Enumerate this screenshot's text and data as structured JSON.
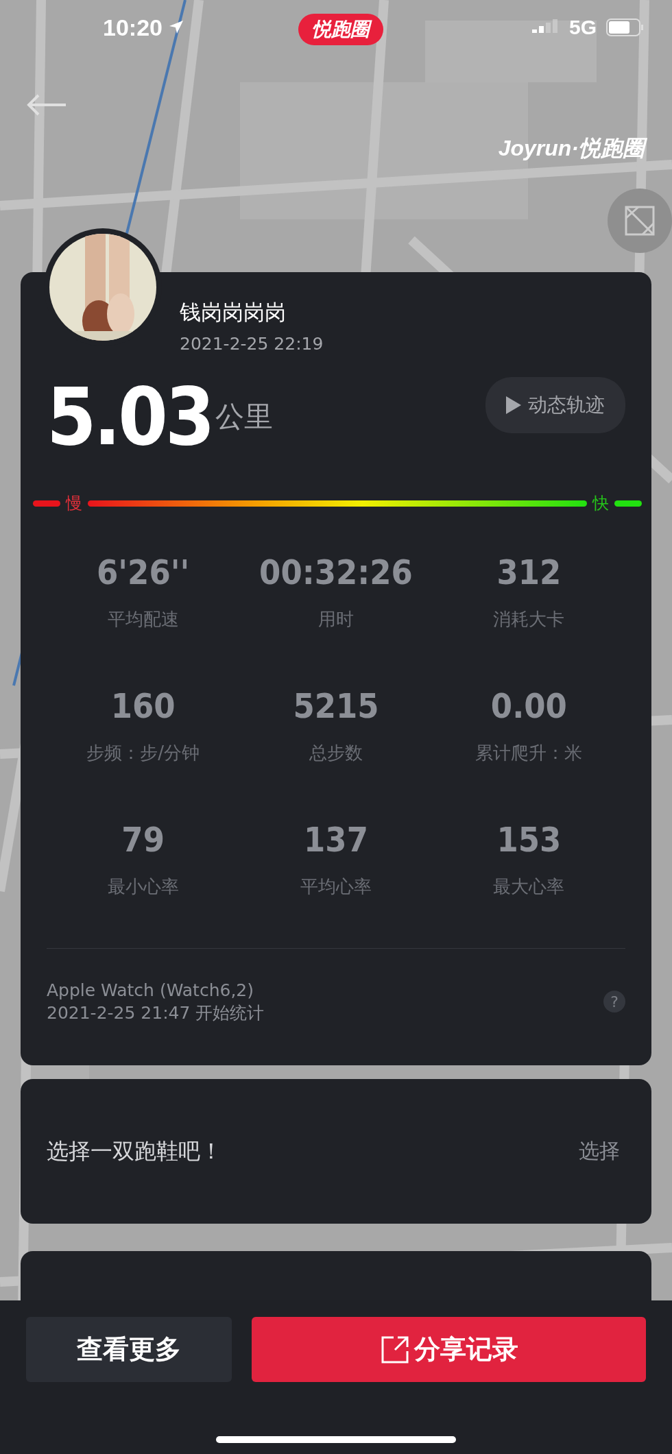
{
  "status_bar": {
    "time": "10:20",
    "network": "5G"
  },
  "app_badge": "悦跑圈",
  "map_overlay": {
    "brand": "Joyrun·悦跑圈"
  },
  "record": {
    "user_name": "钱岗岗岗岗",
    "date": "2021-2-25 22:19",
    "distance": "5.03",
    "distance_unit": "公里",
    "replay_button": "动态轨迹",
    "pace_scale": {
      "slow": "慢",
      "fast": "快"
    },
    "stats": [
      {
        "value": "6'26''",
        "label": "平均配速"
      },
      {
        "value": "00:32:26",
        "label": "用时"
      },
      {
        "value": "312",
        "label": "消耗大卡"
      },
      {
        "value": "160",
        "label": "步频：步/分钟"
      },
      {
        "value": "5215",
        "label": "总步数"
      },
      {
        "value": "0.00",
        "label": "累计爬升：米"
      },
      {
        "value": "79",
        "label": "最小心率"
      },
      {
        "value": "137",
        "label": "平均心率"
      },
      {
        "value": "153",
        "label": "最大心率"
      }
    ],
    "device": "Apple Watch (Watch6,2)",
    "start": "2021-2-25 21:47 开始统计",
    "help": "?"
  },
  "shoes": {
    "prompt": "选择一双跑鞋吧！",
    "action": "选择"
  },
  "actions": [
    {
      "label": "查看更多",
      "kind": "secondary"
    },
    {
      "label": "分享记录",
      "kind": "primary"
    }
  ]
}
